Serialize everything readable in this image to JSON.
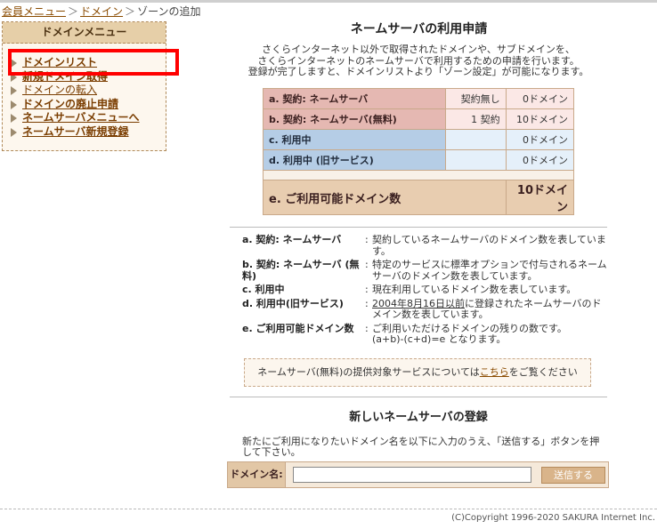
{
  "breadcrumb": {
    "items": [
      {
        "label": "会員メニュー"
      },
      {
        "label": "ドメイン"
      }
    ],
    "separator": "＞",
    "current": "ゾーンの追加"
  },
  "sidebar": {
    "title": "ドメインメニュー",
    "items": [
      {
        "label": "ドメインリスト"
      },
      {
        "label": "新規ドメイン取得"
      },
      {
        "label": "ドメインの転入"
      },
      {
        "label": "ドメインの廃止申請"
      },
      {
        "label": "ネームサーバメニューへ"
      },
      {
        "label": "ネームサーバ新規登録"
      }
    ]
  },
  "main": {
    "title": "ネームサーバの利用申請",
    "intro": [
      "さくらインターネット以外で取得されたドメインや、サブドメインを、",
      "さくらインターネットのネームサーバで利用するための申請を行います。",
      "登録が完了しますと、ドメインリストより「ゾーン設定」が可能になります。"
    ],
    "stats": {
      "rows": [
        {
          "label": "a. 契約: ネームサーバ",
          "value": "契約無し",
          "domains": "0ドメイン"
        },
        {
          "label": "b. 契約: ネームサーバ(無料)",
          "value": "1 契約",
          "domains": "10ドメイン"
        },
        {
          "label": "c. 利用中",
          "value": "",
          "domains": "0ドメイン"
        },
        {
          "label": "d. 利用中 (旧サービス)",
          "value": "",
          "domains": "0ドメイン"
        }
      ],
      "total": {
        "label": "e. ご利用可能ドメイン数",
        "domains": "10ドメイン"
      }
    },
    "definitions": [
      {
        "term": "a. 契約: ネームサーバ",
        "desc": "契約しているネームサーバのドメイン数を表しています。"
      },
      {
        "term": "b. 契約: ネームサーバ (無料)",
        "desc": "特定のサービスに標準オプションで付与されるネームサーバのドメイン数を表しています。"
      },
      {
        "term": "c. 利用中",
        "desc": "現在利用しているドメイン数を表しています。"
      },
      {
        "term": "d. 利用中(旧サービス)",
        "desc_underlined": "2004年8月16日以前",
        "desc": "に登録されたネームサーバのドメイン数を表しています。"
      },
      {
        "term": "e. ご利用可能ドメイン数",
        "desc": "ご利用いただけるドメインの残りの数です。",
        "desc_formula": "(a+b)-(c+d)=e となります。"
      }
    ],
    "notice": {
      "prefix": "ネームサーバ(無料)の提供対象サービスについては",
      "link": "こちら",
      "suffix": "をご覧ください"
    }
  },
  "registration": {
    "title": "新しいネームサーバの登録",
    "description": "新たにご利用になりたいドメイン名を以下に入力のうえ、「送信する」ボタンを押して下さい。",
    "domain_label": "ドメイン名:",
    "domain_value": "",
    "submit_label": "送信する"
  },
  "footer": {
    "copyright": "(C)Copyright 1996-2020 SAKURA Internet Inc."
  }
}
